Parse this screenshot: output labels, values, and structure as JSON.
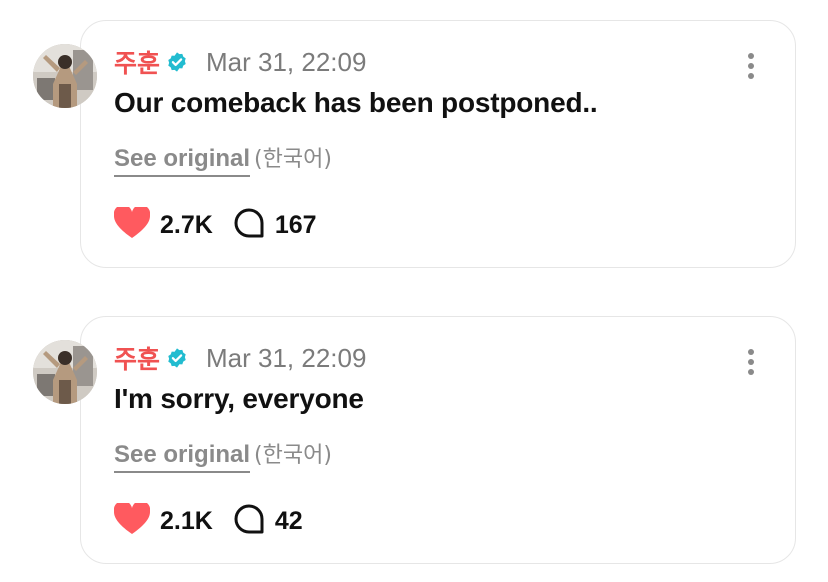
{
  "colors": {
    "author": "#f05252",
    "verified": "#22bcd0",
    "heart": "#ff5a5f",
    "muted": "#8a8a8a"
  },
  "posts": [
    {
      "author": "주훈",
      "verified_icon": "verified-badge-icon",
      "timestamp": "Mar 31, 22:09",
      "text": "Our comeback has been postponed..",
      "see_original": "See original",
      "language": "(한국어)",
      "likes": "2.7K",
      "replies": "167"
    },
    {
      "author": "주훈",
      "verified_icon": "verified-badge-icon",
      "timestamp": "Mar 31, 22:09",
      "text": "I'm sorry, everyone",
      "see_original": "See original",
      "language": "(한국어)",
      "likes": "2.1K",
      "replies": "42"
    }
  ]
}
